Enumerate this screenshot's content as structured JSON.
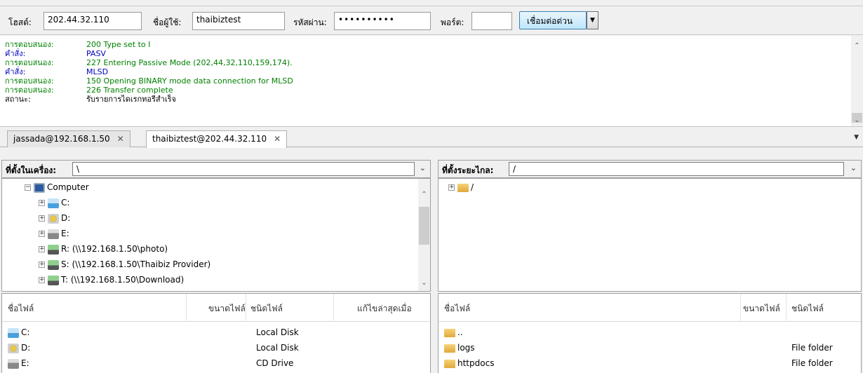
{
  "quickconnect": {
    "host_label": "โฮสต์:",
    "host_value": "202.44.32.110",
    "user_label": "ชื่อผู้ใช้:",
    "user_value": "thaibiztest",
    "pass_label": "รหัสผ่าน:",
    "pass_value": "••••••••••",
    "port_label": "พอร์ต:",
    "port_value": "",
    "connect_label": "เชื่อมต่อด่วน",
    "dropdown_icon": "▼"
  },
  "log": {
    "entries": [
      {
        "type": "response",
        "key": "การตอบสนอง:",
        "text": "200 Type set to I"
      },
      {
        "type": "command",
        "key": "คำสั่ง:",
        "text": "PASV"
      },
      {
        "type": "response",
        "key": "การตอบสนอง:",
        "text": "227 Entering Passive Mode (202,44,32,110,159,174)."
      },
      {
        "type": "command",
        "key": "คำสั่ง:",
        "text": "MLSD"
      },
      {
        "type": "response",
        "key": "การตอบสนอง:",
        "text": "150 Opening BINARY mode data connection for MLSD"
      },
      {
        "type": "response",
        "key": "การตอบสนอง:",
        "text": "226 Transfer complete"
      },
      {
        "type": "status",
        "key": "สถานะ:",
        "text": "รับรายการไดเรกทอรีสำเร็จ"
      }
    ]
  },
  "tabs": [
    {
      "label": "jassada@192.168.1.50",
      "close": "✕"
    },
    {
      "label": "thaibiztest@202.44.32.110",
      "close": "✕"
    }
  ],
  "local": {
    "path_label": "ที่ตั้งในเครื่อง:",
    "path_value": "\\",
    "tree": [
      {
        "label": "Computer",
        "icon": "computer-icon",
        "expander": "−"
      },
      {
        "label": "C:",
        "icon": "drive-c-icon",
        "expander": "+"
      },
      {
        "label": "D:",
        "icon": "cdrom-icon",
        "expander": "+"
      },
      {
        "label": "E:",
        "icon": "hdd-icon",
        "expander": "+"
      },
      {
        "label": "R: (\\\\192.168.1.50\\photo)",
        "icon": "network-drive-icon",
        "expander": "+"
      },
      {
        "label": "S: (\\\\192.168.1.50\\Thaibiz Provider)",
        "icon": "network-drive-icon",
        "expander": "+"
      },
      {
        "label": "T: (\\\\192.168.1.50\\Download)",
        "icon": "network-drive-icon",
        "expander": "+"
      }
    ],
    "columns": {
      "name": "ชื่อไฟล์",
      "size": "ขนาดไฟล์",
      "type": "ชนิดไฟล์",
      "modified": "แก้ไขล่าสุดเมื่อ"
    },
    "files": [
      {
        "name": "C:",
        "type": "Local Disk",
        "icon": "drive-c-icon"
      },
      {
        "name": "D:",
        "type": "Local Disk",
        "icon": "cdrom-icon"
      },
      {
        "name": "E:",
        "type": "CD Drive",
        "icon": "hdd-icon"
      }
    ]
  },
  "remote": {
    "path_label": "ที่ตั้งระยะไกล:",
    "path_value": "/",
    "tree": [
      {
        "label": "/",
        "icon": "folder-icon",
        "expander": "+"
      }
    ],
    "columns": {
      "name": "ชื่อไฟล์",
      "size": "ขนาดไฟล์",
      "type": "ชนิดไฟล์"
    },
    "files": [
      {
        "name": "..",
        "type": "",
        "icon": "folder-icon"
      },
      {
        "name": "logs",
        "type": "File folder",
        "icon": "folder-icon"
      },
      {
        "name": "httpdocs",
        "type": "File folder",
        "icon": "folder-icon"
      }
    ]
  },
  "colors": {
    "response": "#008000",
    "command": "#0000c0",
    "status": "#000000"
  }
}
